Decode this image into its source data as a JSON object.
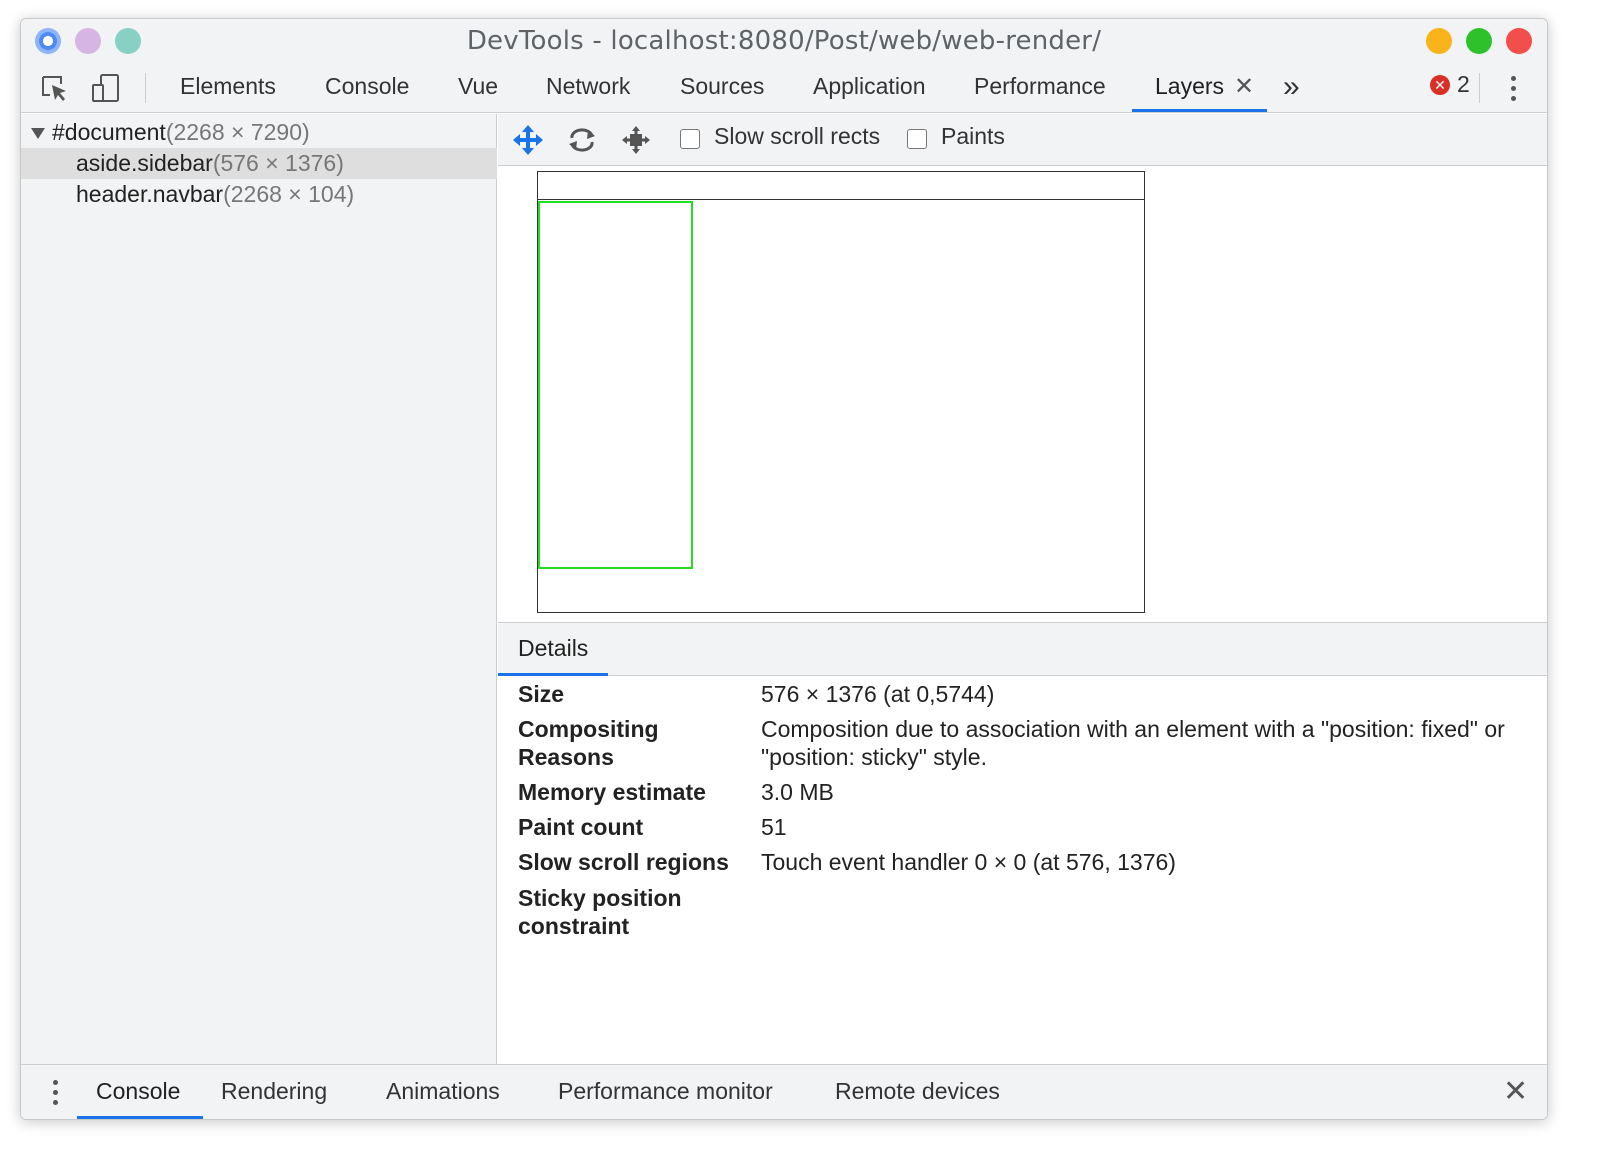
{
  "window": {
    "title": "DevTools - localhost:8080/Post/web/web-render/"
  },
  "toolbar": {
    "tabs": [
      {
        "label": "Elements"
      },
      {
        "label": "Console"
      },
      {
        "label": "Vue"
      },
      {
        "label": "Network"
      },
      {
        "label": "Sources"
      },
      {
        "label": "Application"
      },
      {
        "label": "Performance"
      },
      {
        "label": "Layers"
      }
    ],
    "active_tab": "Layers",
    "close_glyph": "✕",
    "overflow_glyph": "»",
    "error_glyph": "✕",
    "error_count": "2"
  },
  "layer_tree": {
    "rows": [
      {
        "name": "#document",
        "size": "(2268 × 7290)"
      },
      {
        "name": "aside.sidebar",
        "size": "(576 × 1376)"
      },
      {
        "name": "header.navbar",
        "size": "(2268 × 104)"
      }
    ],
    "selected": "aside.sidebar"
  },
  "layer_toolbar": {
    "slow_scroll_label": "Slow scroll rects",
    "paints_label": "Paints"
  },
  "details": {
    "tab": "Details",
    "rows": [
      {
        "label": "Size",
        "value": "576 × 1376 (at 0,5744)"
      },
      {
        "label": "Compositing Reasons",
        "value": "Composition due to association with an element with a \"position: fixed\" or \"position: sticky\" style."
      },
      {
        "label": "Memory estimate",
        "value": "3.0 MB"
      },
      {
        "label": "Paint count",
        "value": "51"
      },
      {
        "label": "Slow scroll regions",
        "value": "Touch event handler 0 × 0 (at 576, 1376)"
      },
      {
        "label": "Sticky position constraint",
        "value": ""
      }
    ]
  },
  "drawer": {
    "tabs": [
      {
        "label": "Console"
      },
      {
        "label": "Rendering"
      },
      {
        "label": "Animations"
      },
      {
        "label": "Performance monitor"
      },
      {
        "label": "Remote devices"
      }
    ],
    "active_tab": "Console",
    "close_glyph": "✕"
  },
  "colors": {
    "accent": "#1a73e8",
    "selected_layer_border": "#22e020",
    "error": "#d93025"
  }
}
